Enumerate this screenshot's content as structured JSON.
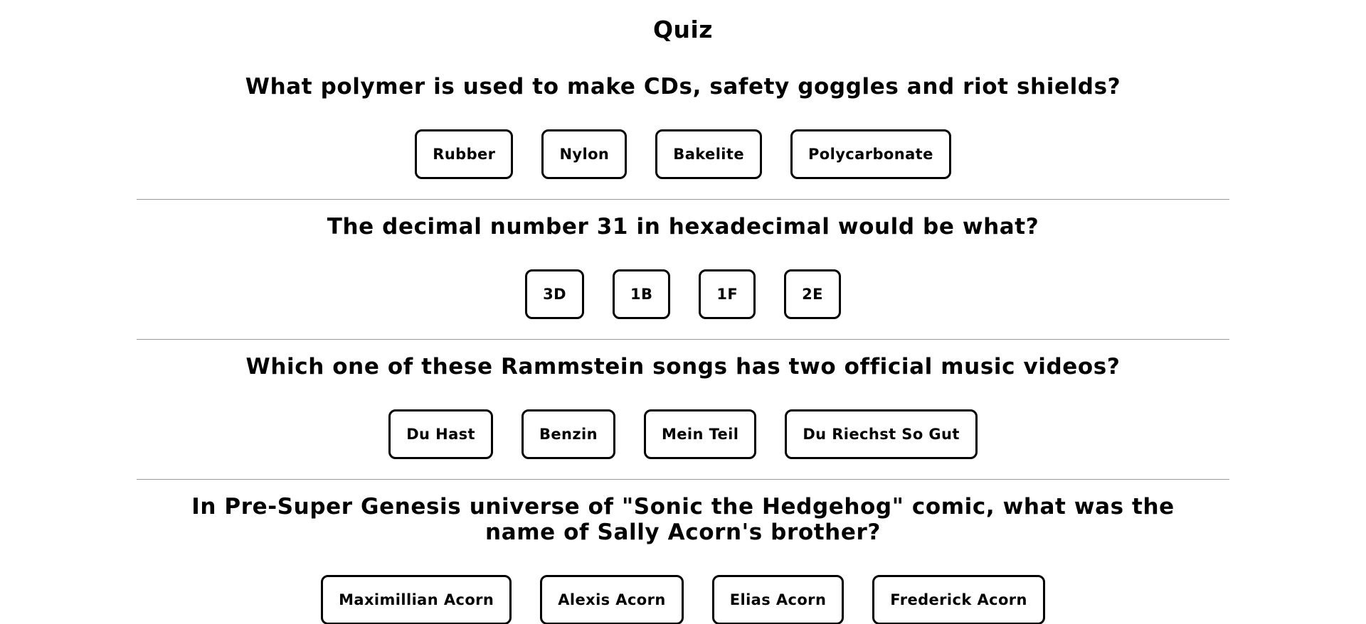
{
  "page": {
    "title": "Quiz"
  },
  "questions": [
    {
      "text": "What polymer is used to make CDs, safety goggles and riot shields?",
      "answers": [
        "Rubber",
        "Nylon",
        "Bakelite",
        "Polycarbonate"
      ]
    },
    {
      "text": "The decimal number 31 in hexadecimal would be what?",
      "answers": [
        "3D",
        "1B",
        "1F",
        "2E"
      ]
    },
    {
      "text": "Which one of these Rammstein songs has two official music videos?",
      "answers": [
        "Du Hast",
        "Benzin",
        "Mein Teil",
        "Du Riechst So Gut"
      ]
    },
    {
      "text": "In Pre-Super Genesis universe of \"Sonic the Hedgehog\" comic, what was the name of Sally Acorn's brother?",
      "answers": [
        "Maximillian Acorn",
        "Alexis Acorn",
        "Elias Acorn",
        "Frederick Acorn"
      ]
    }
  ]
}
